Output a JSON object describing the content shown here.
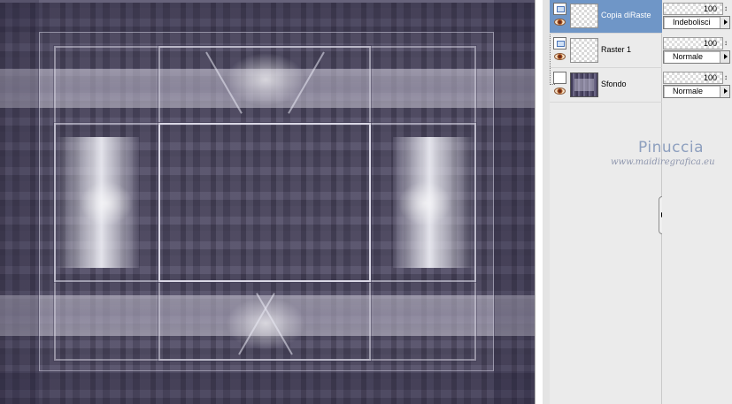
{
  "canvas": {
    "label": "image-canvas"
  },
  "layers": [
    {
      "name": "Copia diRaste",
      "selected": true,
      "thumbnail": "transparent",
      "visible_icon": "eye-icon",
      "mask_icon": "layer-type-icon",
      "opacity": "100",
      "blend_mode": "Indebolisci"
    },
    {
      "name": "Raster 1",
      "selected": false,
      "thumbnail": "transparent",
      "visible_icon": "eye-icon",
      "mask_icon": "layer-type-icon",
      "opacity": "100",
      "blend_mode": "Normale"
    },
    {
      "name": "Sfondo",
      "selected": false,
      "thumbnail": "image",
      "visible_icon": "eye-icon",
      "mask_icon": "layer-type-icon",
      "opacity": "100",
      "blend_mode": "Normale"
    }
  ],
  "watermark": {
    "name": "Pinuccia",
    "url": "www.maidiregrafica.eu"
  },
  "colors": {
    "selection": "#6f96c7",
    "canvas_base": "#4d4862",
    "panel_bg": "#ebebeb",
    "watermark": "#8d9fbe"
  }
}
